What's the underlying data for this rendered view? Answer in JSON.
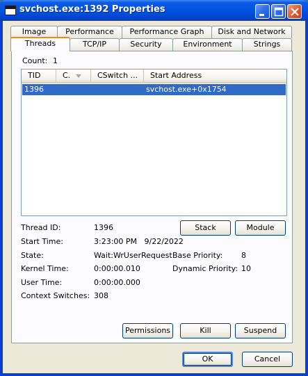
{
  "window": {
    "title": "svchost.exe:1392 Properties"
  },
  "tabs": {
    "row_back": [
      "Image",
      "Performance",
      "Performance Graph",
      "Disk and Network"
    ],
    "row_front": [
      "Threads",
      "TCP/IP",
      "Security",
      "Environment",
      "Strings"
    ],
    "active": "Threads"
  },
  "threads": {
    "count_label": "Count:",
    "count_value": "1",
    "columns": [
      "TID",
      "C.",
      "CSwitch ...",
      "Start Address"
    ],
    "rows": [
      {
        "tid": "1396",
        "c": "",
        "cswitch": "",
        "start_address": "svchost.exe+0x1754"
      }
    ]
  },
  "details": {
    "thread_id_label": "Thread ID:",
    "thread_id_value": "1396",
    "start_time_label": "Start Time:",
    "start_time_value": "3:23:00 PM   9/22/2022",
    "state_label": "State:",
    "state_value": "Wait:WrUserRequest",
    "base_priority_label": "Base Priority:",
    "base_priority_value": "8",
    "kernel_time_label": "Kernel Time:",
    "kernel_time_value": "0:00:00.010",
    "dynamic_priority_label": "Dynamic Priority:",
    "dynamic_priority_value": "10",
    "user_time_label": "User Time:",
    "user_time_value": "0:00:00.000",
    "context_switches_label": "Context Switches:",
    "context_switches_value": "308"
  },
  "buttons": {
    "stack": "Stack",
    "module": "Module",
    "permissions": "Permissions",
    "kill": "Kill",
    "suspend": "Suspend",
    "ok": "OK",
    "cancel": "Cancel"
  },
  "colors": {
    "titlebar": "#0053e1",
    "selection": "#316ac5",
    "dialog_face": "#ece9d8",
    "active_tab_accent": "#e68b2c"
  },
  "icons": {
    "window": "app-window-icon",
    "minimize": "minimize-icon",
    "maximize": "maximize-icon",
    "close": "close-icon",
    "sort": "sort-arrow-icon"
  }
}
